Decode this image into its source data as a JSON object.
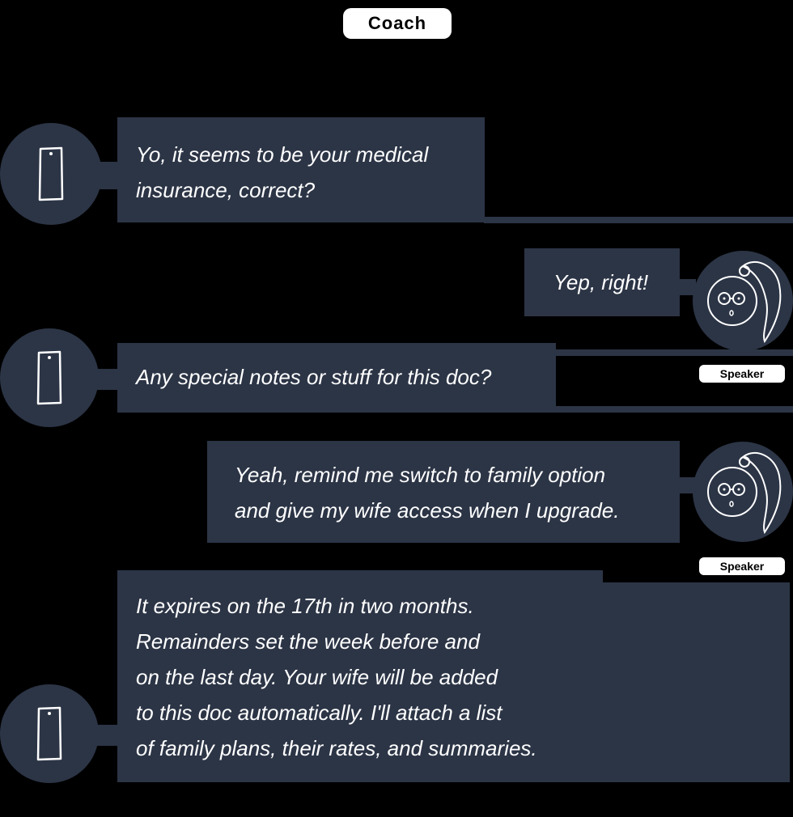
{
  "header": {
    "title": "Coach"
  },
  "messages": [
    {
      "sender": "assistant",
      "text": "Yo, it seems to be your medical\ninsurance, correct?"
    },
    {
      "sender": "user",
      "text": "Yep, right!"
    },
    {
      "sender": "assistant",
      "text": "Any special notes or stuff for this doc?"
    },
    {
      "sender": "user",
      "text": "Yeah, remind me switch to family option\nand give my wife access when I upgrade."
    },
    {
      "sender": "assistant",
      "text": "It expires on the 17th in two months.\nRemainders set the week before and\non the last day. Your wife will be added\nto this doc automatically. I'll attach a list\nof family plans, their rates, and summaries."
    }
  ],
  "user_labels": [
    "Speaker",
    "Speaker"
  ],
  "icons": {
    "assistant_avatar": "phone-icon",
    "user_avatar": "girl-face-icon"
  },
  "colors": {
    "background": "#000000",
    "bubble": "#2c3546",
    "text": "#ffffff",
    "label_pill": "#ffffff"
  }
}
